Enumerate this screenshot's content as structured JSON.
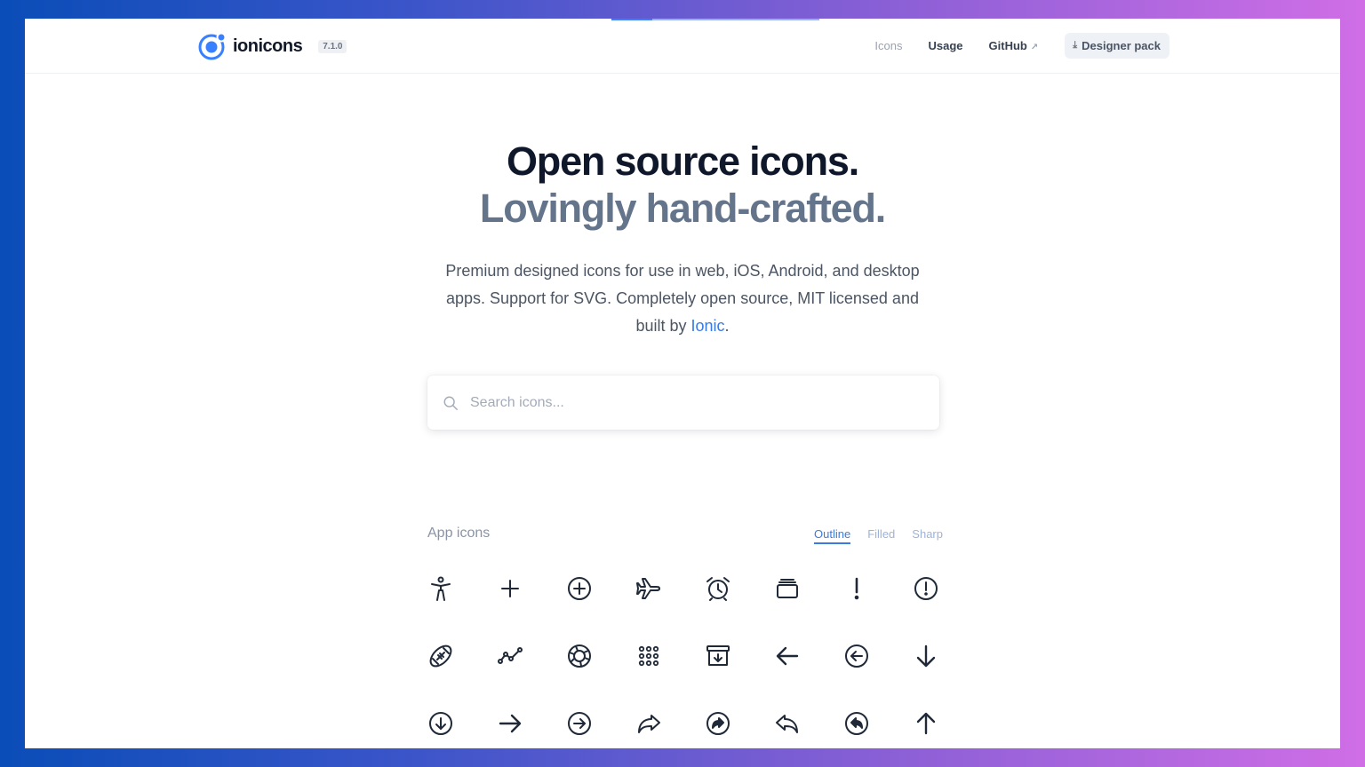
{
  "header": {
    "logo_text": "ionicons",
    "version": "7.1.0",
    "nav": {
      "icons": "Icons",
      "usage": "Usage",
      "github": "GitHub",
      "github_ext": "↗"
    },
    "designer_pack": "Designer pack",
    "download_glyph": "⤓"
  },
  "hero": {
    "title_line1": "Open source icons.",
    "title_line2": "Lovingly hand-crafted.",
    "desc_text": "Premium designed icons for use in web, iOS, Android, and desktop apps. Support for SVG. Completely open source, MIT licensed and built by ",
    "desc_link": "Ionic",
    "desc_end": "."
  },
  "search": {
    "placeholder": "Search icons..."
  },
  "icons_section": {
    "title": "App icons",
    "tabs": {
      "outline": "Outline",
      "filled": "Filled",
      "sharp": "Sharp"
    },
    "active_tab": "Outline",
    "icons": [
      "accessibility-outline-icon",
      "add-outline-icon",
      "add-circle-outline-icon",
      "airplane-outline-icon",
      "alarm-outline-icon",
      "albums-outline-icon",
      "alert-outline-icon",
      "alert-circle-outline-icon",
      "american-football-outline-icon",
      "analytics-outline-icon",
      "aperture-outline-icon",
      "apps-outline-icon",
      "archive-outline-icon",
      "arrow-back-outline-icon",
      "arrow-back-circle-outline-icon",
      "arrow-down-outline-icon",
      "arrow-down-circle-outline-icon",
      "arrow-forward-outline-icon",
      "arrow-forward-circle-outline-icon",
      "arrow-redo-outline-icon",
      "arrow-redo-circle-outline-icon",
      "arrow-undo-outline-icon",
      "arrow-undo-circle-outline-icon",
      "arrow-up-outline-icon"
    ]
  },
  "colors": {
    "accent": "#3b7ae0",
    "heading": "#0f172a",
    "subheading": "#64748b",
    "bg_gradient_start": "#0a4db8",
    "bg_gradient_end": "#d06ee6"
  }
}
